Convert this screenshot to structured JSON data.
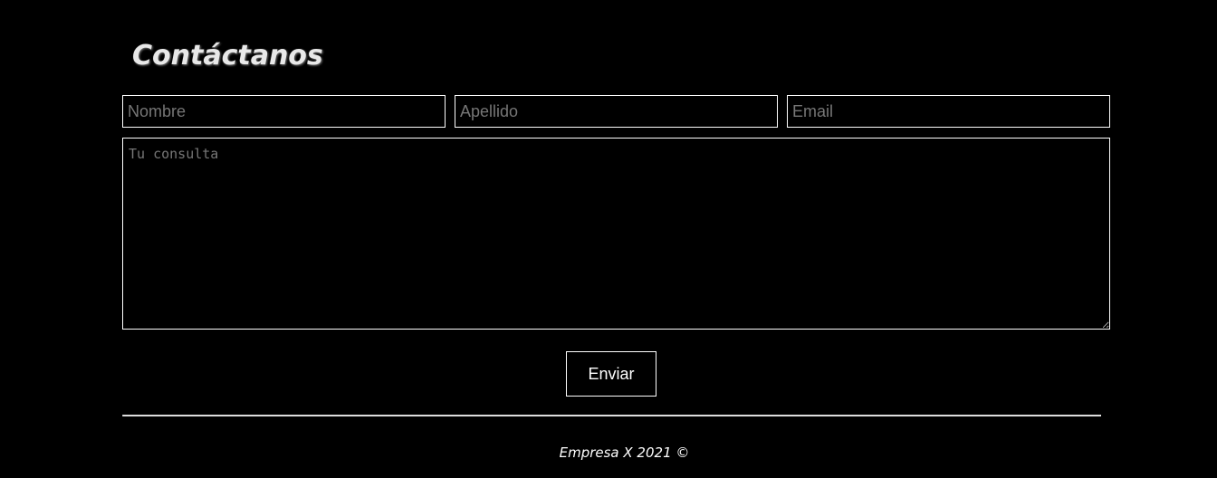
{
  "contact": {
    "title": "Contáctanos",
    "fields": {
      "nombre_placeholder": "Nombre",
      "apellido_placeholder": "Apellido",
      "email_placeholder": "Email"
    },
    "message_placeholder": "Tu consulta",
    "submit_label": "Enviar"
  },
  "footer": {
    "text": "Empresa X 2021 ©"
  },
  "colors": {
    "background": "#000000",
    "text": "#ffffff",
    "placeholder": "#767676",
    "border": "#ffffff"
  }
}
